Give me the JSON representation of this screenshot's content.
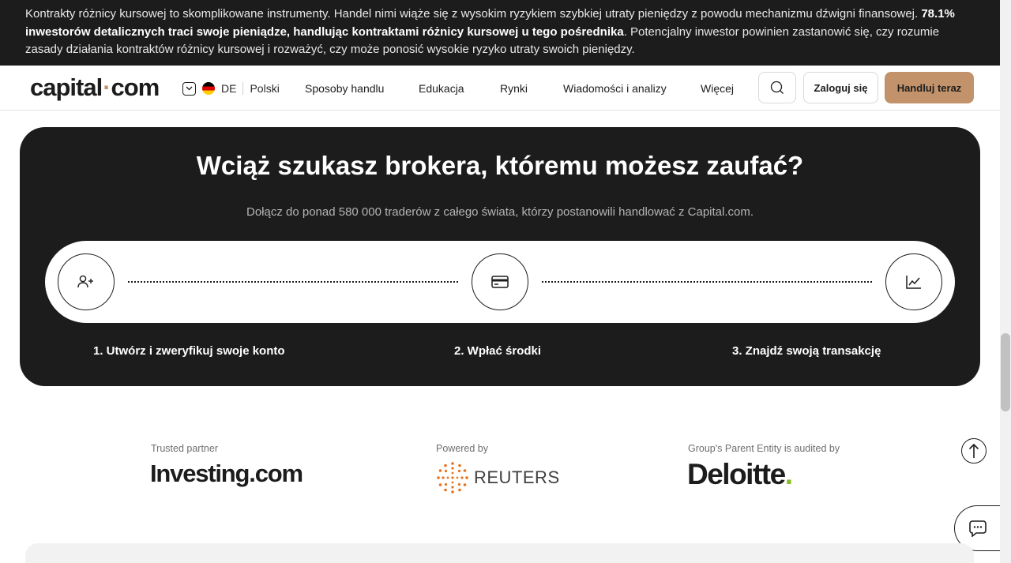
{
  "risk_banner": {
    "text_before": "Kontrakty różnicy kursowej to skomplikowane instrumenty. Handel nimi wiąże się z wysokim ryzykiem szybkiej utraty pieniędzy z powodu mechanizmu dźwigni finansowej. ",
    "text_bold": "78.1% inwestorów detalicznych traci swoje pieniądze, handlując kontraktami różnicy kursowej u tego pośrednika",
    "text_after": ". Potencjalny inwestor powinien zastanowić się, czy rozumie zasady działania kontraktów różnicy kursowej i rozważyć, czy może ponosić wysokie ryzyko utraty swoich pieniędzy."
  },
  "header": {
    "logo_left": "capital",
    "logo_dot": "·",
    "logo_right": "com",
    "lang_code": "DE",
    "lang_name": "Polski",
    "nav": [
      "Sposoby handlu",
      "Edukacja",
      "Rynki",
      "Wiadomości i analizy",
      "Więcej"
    ],
    "login_label": "Zaloguj się",
    "trade_label": "Handluj teraz"
  },
  "promo": {
    "title": "Wciąż szukasz brokera, któremu możesz zaufać?",
    "subtitle": "Dołącz do ponad 580 000 traderów z całego świata, którzy postanowili handlować z Capital.com.",
    "steps": [
      {
        "label": "1. Utwórz i zweryfikuj swoje konto",
        "icon": "add-user-icon"
      },
      {
        "label": "2. Wpłać środki",
        "icon": "credit-card-icon"
      },
      {
        "label": "3. Znajdź swoją transakcję",
        "icon": "chart-line-icon"
      }
    ]
  },
  "partners": {
    "investing_caption": "Trusted partner",
    "investing_name": "Investing",
    "investing_suffix": ".com",
    "reuters_caption": "Powered by",
    "reuters_name": "REUTERS",
    "deloitte_caption": "Group's Parent Entity is audited by",
    "deloitte_name": "Deloitte",
    "deloitte_dot": "."
  },
  "colors": {
    "brand_accent": "#c2936a",
    "dark": "#1c1c1c",
    "deloitte_green": "#86bc25",
    "reuters_orange": "#e8711c"
  }
}
